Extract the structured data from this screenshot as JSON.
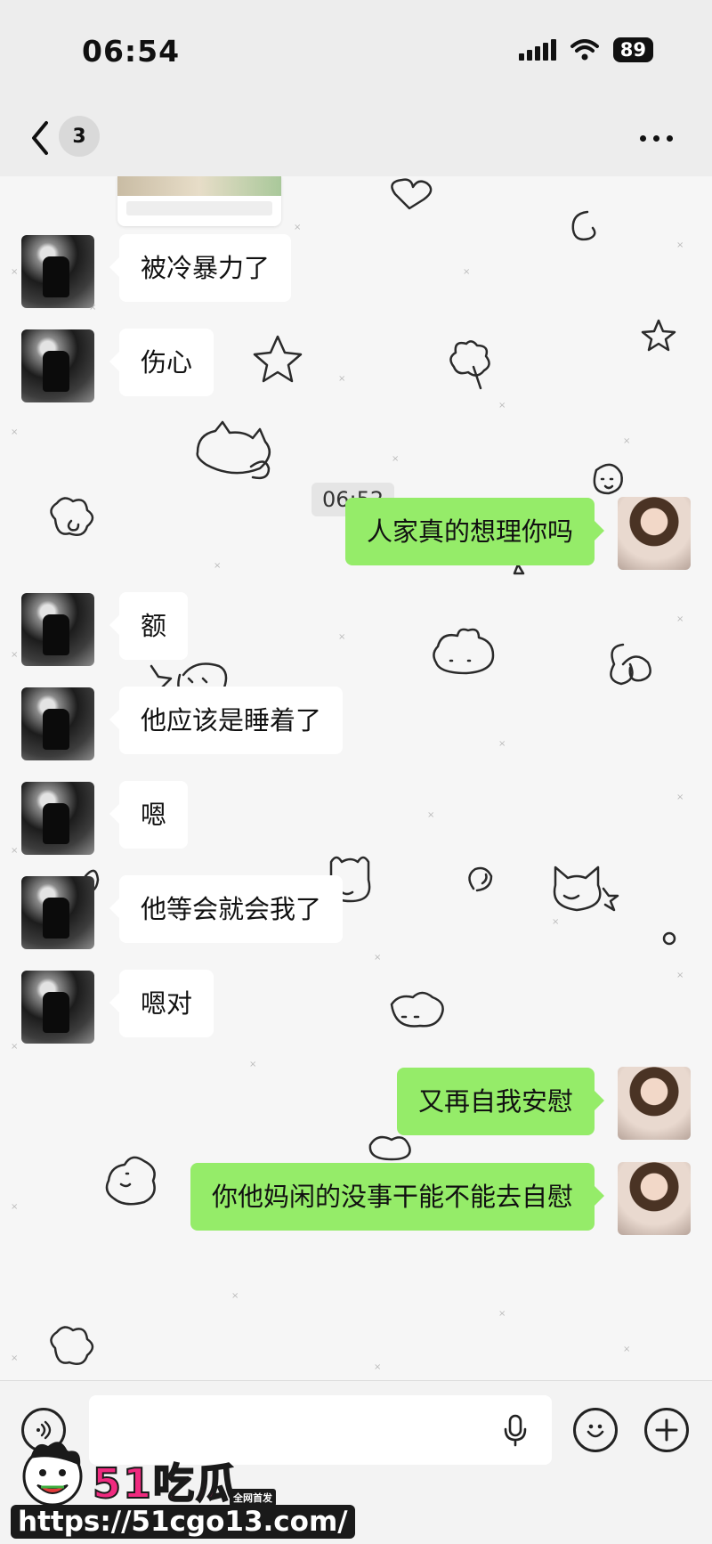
{
  "status_bar": {
    "time": "06:54",
    "battery": "89"
  },
  "nav": {
    "unread_count": "3"
  },
  "chat": {
    "timestamp": "06:52",
    "messages": [
      {
        "from": "friend",
        "text": "被冷暴力了"
      },
      {
        "from": "friend",
        "text": "伤心"
      },
      {
        "from": "me",
        "text": "人家真的想理你吗"
      },
      {
        "from": "friend",
        "text": "额"
      },
      {
        "from": "friend",
        "text": "他应该是睡着了"
      },
      {
        "from": "friend",
        "text": "嗯"
      },
      {
        "from": "friend",
        "text": "他等会就会我了"
      },
      {
        "from": "friend",
        "text": "嗯对"
      },
      {
        "from": "me",
        "text": "又再自我安慰"
      },
      {
        "from": "me",
        "text": "你他妈闲的没事干能不能去自慰"
      }
    ]
  },
  "watermark": {
    "brand": "51吃瓜",
    "tag": "全网首发",
    "url": "https://51cgo13.com/"
  },
  "colors": {
    "outgoing_bubble": "#95ec69",
    "incoming_bubble": "#ffffff",
    "background": "#f6f6f6"
  },
  "icons": [
    "signal-icon",
    "wifi-icon",
    "battery-icon",
    "back-icon",
    "more-icon",
    "voice-icon",
    "mic-icon",
    "emoji-icon",
    "add-icon"
  ]
}
